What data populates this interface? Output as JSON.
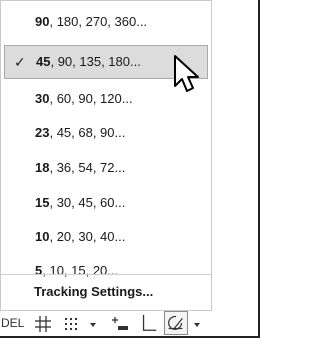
{
  "menu": {
    "items": [
      {
        "lead": "90",
        "rest": ", 180, 270, 360...",
        "checked": false
      },
      {
        "lead": "45",
        "rest": ", 90, 135, 180...",
        "checked": true
      },
      {
        "lead": "30",
        "rest": ", 60, 90, 120...",
        "checked": false
      },
      {
        "lead": "23",
        "rest": ", 45, 68, 90...",
        "checked": false
      },
      {
        "lead": "18",
        "rest": ", 36, 54, 72...",
        "checked": false
      },
      {
        "lead": "15",
        "rest": ", 30, 45, 60...",
        "checked": false
      },
      {
        "lead": "10",
        "rest": ", 20, 30, 40...",
        "checked": false
      },
      {
        "lead": "5",
        "rest": ", 10, 15, 20...",
        "checked": false
      }
    ],
    "check_glyph": "✓",
    "settings_label": "Tracking Settings..."
  },
  "statusbar": {
    "mode_text": "DEL",
    "icons": [
      "grid-icon",
      "snap-icon",
      "dropdown-arrow-icon",
      "infer-constraints-icon",
      "ortho-icon",
      "polar-tracking-icon",
      "dropdown-arrow-icon"
    ]
  }
}
